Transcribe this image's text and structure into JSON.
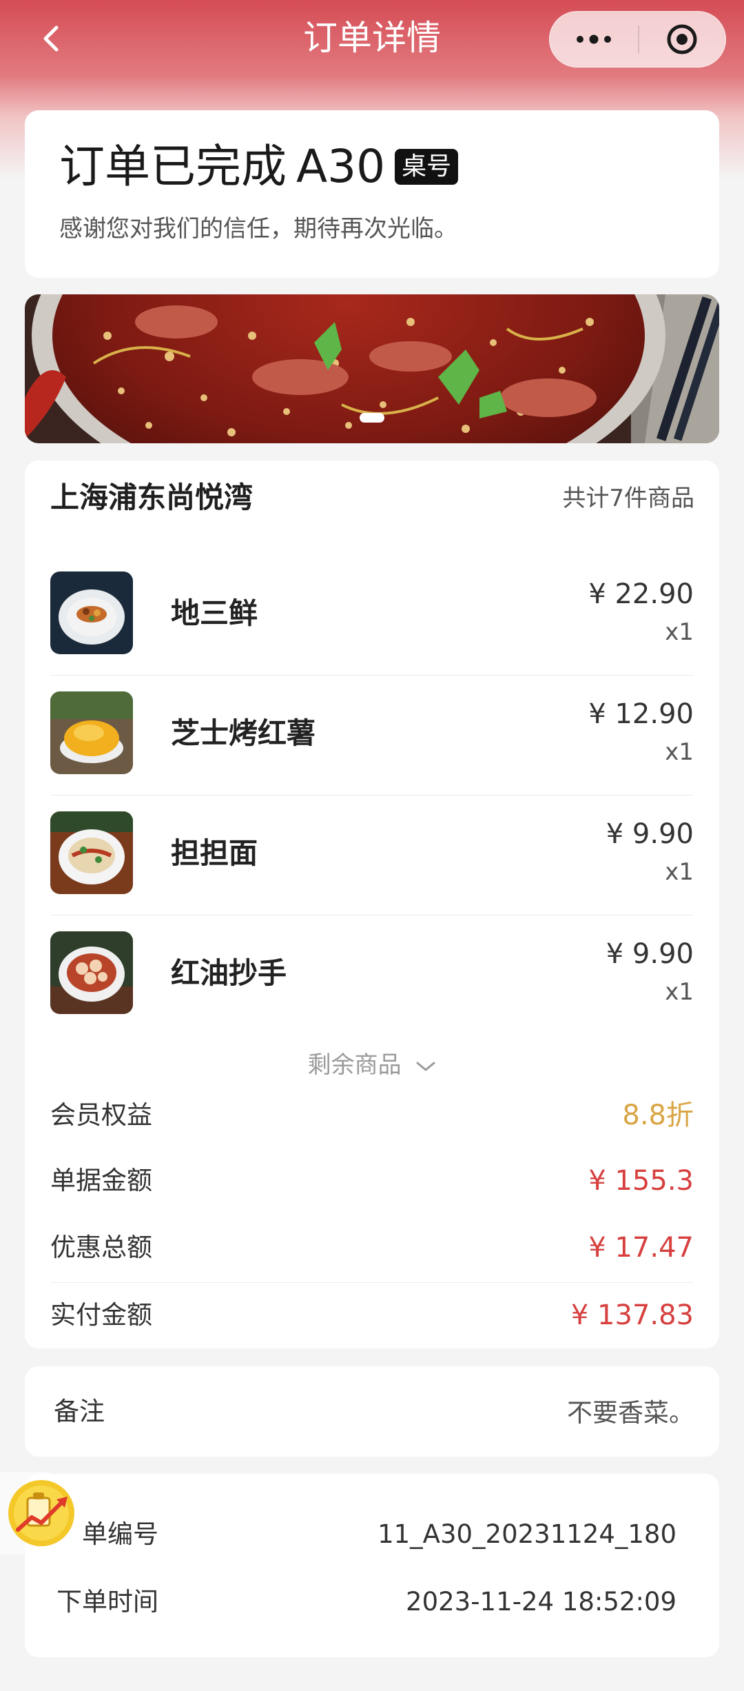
{
  "header": {
    "title": "订单详情"
  },
  "status": {
    "title": "订单已完成",
    "table_number": "A30",
    "table_badge": "桌号",
    "subtitle": "感谢您对我们的信任，期待再次光临。"
  },
  "order": {
    "store_name": "上海浦东尚悦湾",
    "item_count": "共计7件商品",
    "items": [
      {
        "name": "地三鲜",
        "price": "¥ 22.90",
        "qty": "x1"
      },
      {
        "name": "芝士烤红薯",
        "price": "¥ 12.90",
        "qty": "x1"
      },
      {
        "name": "担担面",
        "price": "¥ 9.90",
        "qty": "x1"
      },
      {
        "name": "红油抄手",
        "price": "¥ 9.90",
        "qty": "x1"
      }
    ],
    "more_items_label": "剩余商品"
  },
  "summary": {
    "member_benefit_label": "会员权益",
    "member_benefit_value": "8.8折",
    "bill_amount_label": "单据金额",
    "bill_amount_value": "¥ 155.3",
    "discount_total_label": "优惠总额",
    "discount_total_value": "¥ 17.47",
    "paid_amount_label": "实付金额",
    "paid_amount_value": "¥ 137.83"
  },
  "remark": {
    "label": "备注",
    "value": "不要香菜。"
  },
  "info": {
    "order_no_label": "单编号",
    "order_no_value": "11_A30_20231124_180",
    "order_time_label": "下单时间",
    "order_time_value": "2023-11-24 18:52:09"
  },
  "colors": {
    "header_red": "#d54c55",
    "price_red": "#d6403f",
    "member_gold": "#d9a443",
    "background": "#f4f4f4"
  },
  "icons": {
    "back": "chevron-left-icon",
    "more": "more-dots-icon",
    "close": "target-close-icon",
    "more_items": "chevron-down-icon",
    "float_badge": "growth-chart-icon"
  }
}
